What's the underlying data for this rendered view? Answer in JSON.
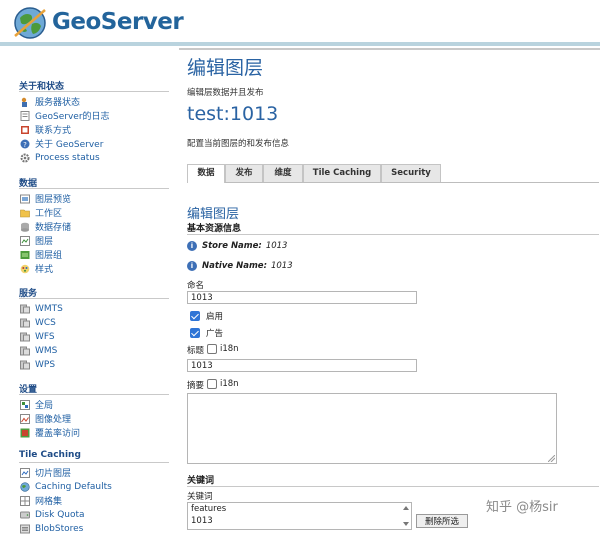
{
  "header": {
    "brand": "GeoServer"
  },
  "sidebar": {
    "sections": [
      {
        "title": "关于和状态",
        "items": [
          {
            "label": "服务器状态",
            "icon": "server-status-icon"
          },
          {
            "label": "GeoServer的日志",
            "icon": "log-icon"
          },
          {
            "label": "联系方式",
            "icon": "contact-icon"
          },
          {
            "label": "关于 GeoServer",
            "icon": "about-icon"
          },
          {
            "label": "Process status",
            "icon": "gear-icon"
          }
        ]
      },
      {
        "title": "数据",
        "items": [
          {
            "label": "图层预览",
            "icon": "layer-preview-icon"
          },
          {
            "label": "工作区",
            "icon": "folder-icon"
          },
          {
            "label": "数据存储",
            "icon": "datastore-icon"
          },
          {
            "label": "图层",
            "icon": "layer-icon"
          },
          {
            "label": "图层组",
            "icon": "layer-group-icon"
          },
          {
            "label": "样式",
            "icon": "style-icon"
          }
        ]
      },
      {
        "title": "服务",
        "items": [
          {
            "label": "WMTS",
            "icon": "service-icon"
          },
          {
            "label": "WCS",
            "icon": "service-icon"
          },
          {
            "label": "WFS",
            "icon": "service-icon"
          },
          {
            "label": "WMS",
            "icon": "service-icon"
          },
          {
            "label": "WPS",
            "icon": "service-icon"
          }
        ]
      },
      {
        "title": "设置",
        "items": [
          {
            "label": "全局",
            "icon": "global-settings-icon"
          },
          {
            "label": "图像处理",
            "icon": "image-processing-icon"
          },
          {
            "label": "覆盖率访问",
            "icon": "coverage-access-icon"
          }
        ]
      },
      {
        "title": "Tile Caching",
        "items": [
          {
            "label": "切片图层",
            "icon": "tile-layers-icon"
          },
          {
            "label": "Caching Defaults",
            "icon": "globe-icon"
          },
          {
            "label": "网格集",
            "icon": "gridset-icon"
          },
          {
            "label": "Disk Quota",
            "icon": "disk-icon"
          },
          {
            "label": "BlobStores",
            "icon": "blobstore-icon"
          }
        ]
      }
    ]
  },
  "main": {
    "page_title": "编辑图层",
    "page_desc": "编辑层数据并且发布",
    "layer_name": "test:1013",
    "layer_desc": "配置当前图层的和发布信息",
    "tabs": [
      "数据",
      "发布",
      "维度",
      "Tile Caching",
      "Security"
    ],
    "active_tab": "数据",
    "panel_title": "编辑图层",
    "panel_subtitle": "基本资源信息",
    "store_key": "Store Name:",
    "store_val": "1013",
    "native_key": "Native Name:",
    "native_val": "1013",
    "name_label": "命名",
    "name_value": "1013",
    "enabled_label": "启用",
    "enabled": true,
    "advertised_label": "广告",
    "advertised": true,
    "title_label": "标题",
    "i18n_label": "i18n",
    "title_value": "1013",
    "abstract_label": "摘要",
    "keywords_title": "关键词",
    "keywords_label": "关键词",
    "keywords": [
      "features",
      "1013"
    ],
    "remove_button": "删除所选"
  },
  "watermark": "知乎 @杨sir",
  "colors": {
    "brand": "#23649b",
    "link": "#1f5fa3",
    "heading": "#2a63a3",
    "checkbox": "#2f75d6"
  }
}
